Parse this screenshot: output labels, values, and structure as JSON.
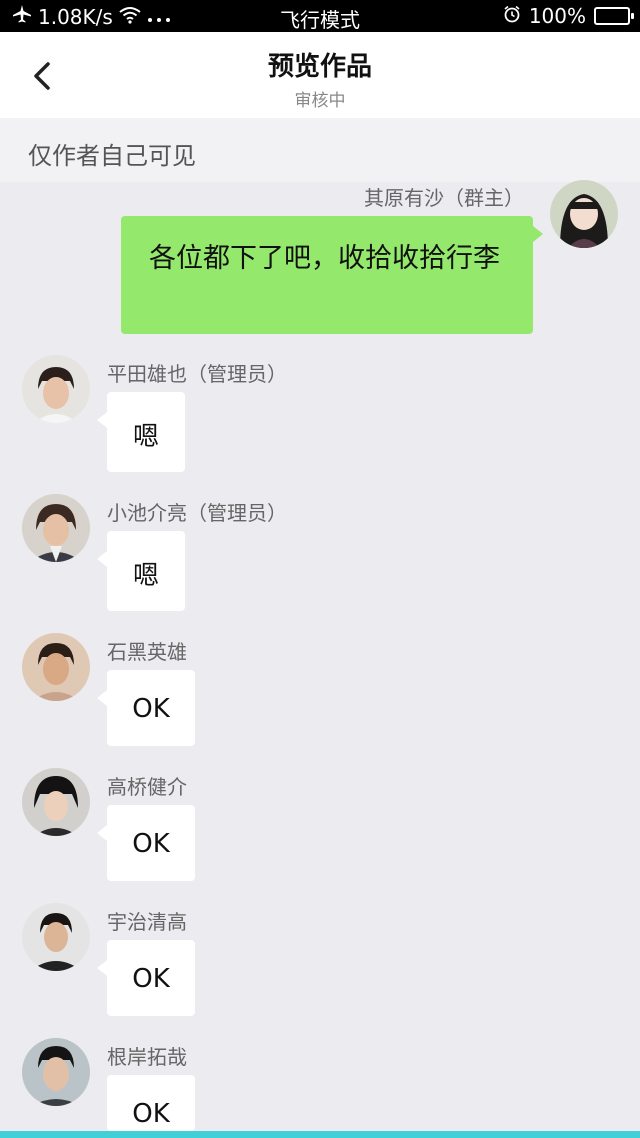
{
  "status": {
    "network_speed": "1.08K/s",
    "mode": "飞行模式",
    "battery": "100%"
  },
  "nav": {
    "title": "预览作品",
    "subtitle": "审核中"
  },
  "notice": "仅作者自己可见",
  "messages": [
    {
      "name": "其原有沙（群主）",
      "text": "各位都下了吧，收拾收拾行李",
      "self": true
    },
    {
      "name": "平田雄也（管理员）",
      "text": "嗯"
    },
    {
      "name": "小池介亮（管理员）",
      "text": "嗯"
    },
    {
      "name": "石黑英雄",
      "text": "OK"
    },
    {
      "name": "高桥健介",
      "text": "OK"
    },
    {
      "name": "宇治清高",
      "text": "OK"
    },
    {
      "name": "根岸拓哉",
      "text": "OK"
    }
  ],
  "colors": {
    "background": "#ebebf0",
    "self_bubble": "#94e86c",
    "bottom_bar": "#3fd0d8"
  }
}
